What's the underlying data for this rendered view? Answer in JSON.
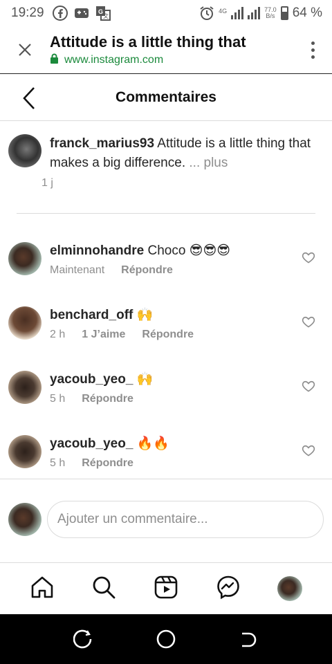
{
  "status_bar": {
    "time": "19:29",
    "network": "4G",
    "speed": "77.0",
    "speed_unit": "B/s",
    "battery": "64 %"
  },
  "browser": {
    "page_title": "Attitude is a little thing that",
    "url": "www.instagram.com"
  },
  "header": {
    "title": "Commentaires"
  },
  "caption": {
    "username": "franck_marius93",
    "text": "Attitude is a little thing that makes a big difference.",
    "ellipsis": "...",
    "more": "plus",
    "time": "1 j"
  },
  "comments": [
    {
      "username": "elminnohandre",
      "text": "Choco 😎😎😎",
      "time": "Maintenant",
      "likes": "",
      "reply": "Répondre"
    },
    {
      "username": "benchard_off",
      "text": "🙌",
      "time": "2 h",
      "likes": "1 J’aime",
      "reply": "Répondre"
    },
    {
      "username": "yacoub_yeo_",
      "text": "🙌",
      "time": "5 h",
      "likes": "",
      "reply": "Répondre"
    },
    {
      "username": "yacoub_yeo_",
      "text": "🔥🔥",
      "time": "5 h",
      "likes": "",
      "reply": "Répondre"
    }
  ],
  "composer": {
    "placeholder": "Ajouter un commentaire..."
  },
  "icons": {
    "close": "close-icon",
    "menu": "more-vertical-icon",
    "back": "chevron-left-icon",
    "heart": "heart-outline-icon",
    "home": "home-icon",
    "search": "search-icon",
    "reels": "reels-icon",
    "messenger": "messenger-icon"
  }
}
